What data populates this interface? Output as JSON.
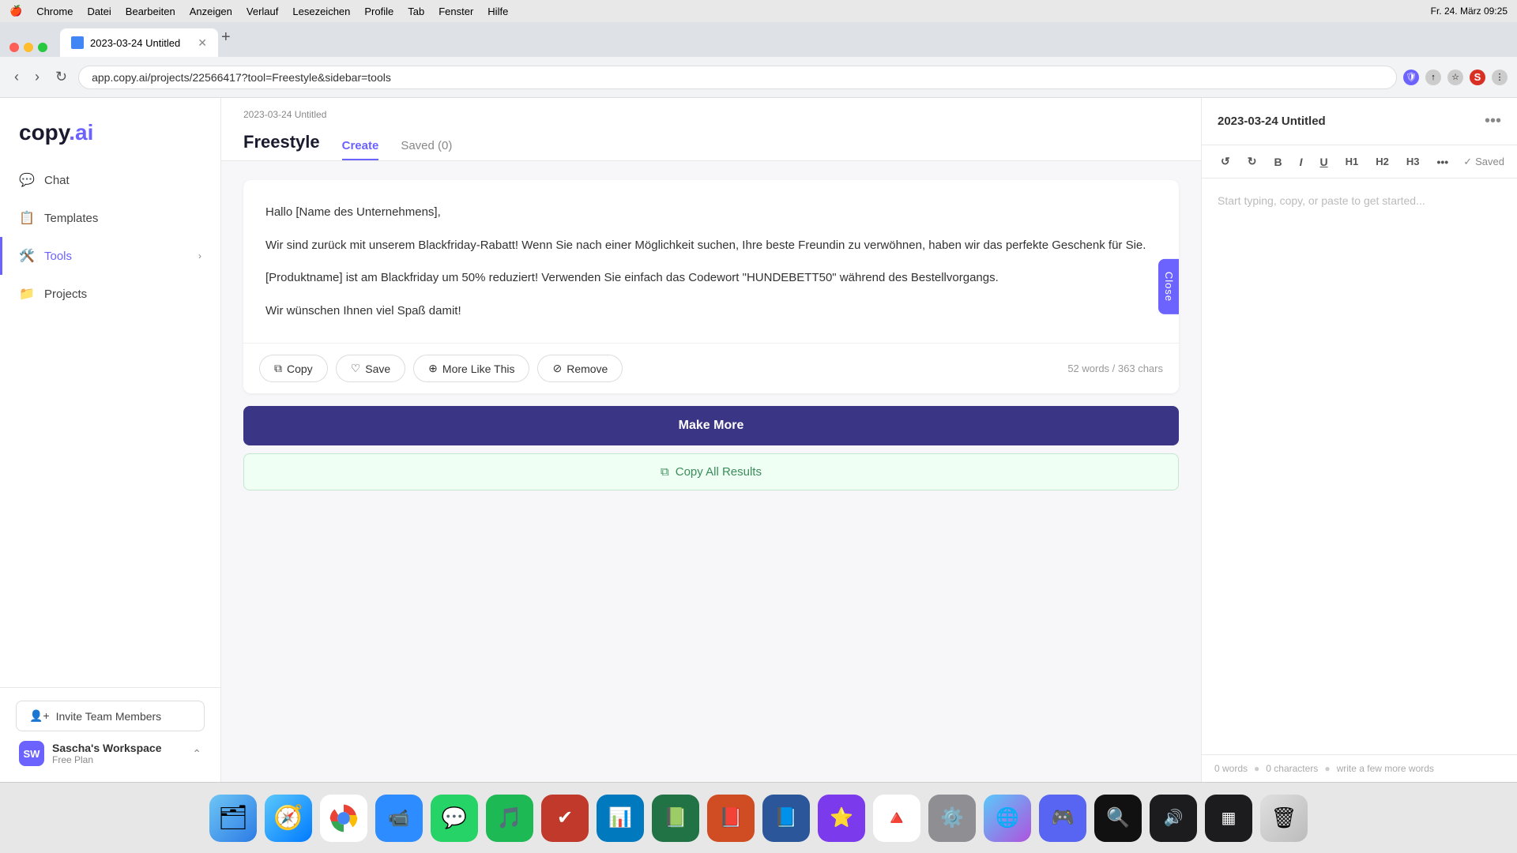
{
  "menubar": {
    "apple": "🍎",
    "items": [
      "Chrome",
      "Datei",
      "Bearbeiten",
      "Anzeigen",
      "Verlauf",
      "Lesezeichen",
      "Profile",
      "Tab",
      "Fenster",
      "Hilfe"
    ],
    "datetime": "Fr. 24. März 09:25"
  },
  "browser": {
    "tab_title": "2023-03-24 Untitled",
    "url": "app.copy.ai/projects/22566417?tool=Freestyle&sidebar=tools"
  },
  "sidebar": {
    "logo": "copy.ai",
    "nav_items": [
      {
        "id": "chat",
        "label": "Chat",
        "icon": "💬"
      },
      {
        "id": "templates",
        "label": "Templates",
        "icon": "📋"
      },
      {
        "id": "tools",
        "label": "Tools",
        "icon": "🛠️",
        "active": true,
        "hasChevron": true
      },
      {
        "id": "projects",
        "label": "Projects",
        "icon": "📁"
      }
    ],
    "invite_label": "Invite Team Members",
    "workspace": {
      "name": "Sascha's Workspace",
      "initials": "SW",
      "plan": "Free Plan"
    }
  },
  "header": {
    "breadcrumb": "2023-03-24 Untitled",
    "title": "Freestyle",
    "tabs": [
      {
        "label": "Create",
        "active": true
      },
      {
        "label": "Saved (0)",
        "active": false
      }
    ]
  },
  "result": {
    "paragraph1": "Hallo [Name des Unternehmens],",
    "paragraph2": "Wir sind zurück mit unserem Blackfriday-Rabatt! Wenn Sie nach einer Möglichkeit suchen, Ihre beste Freundin zu verwöhnen, haben wir das perfekte Geschenk für Sie.",
    "paragraph3": "[Produktname] ist am Blackfriday um 50% reduziert! Verwenden Sie einfach das Codewort \"HUNDEBETT50\" während des Bestellvorgangs.",
    "paragraph4": "Wir wünschen Ihnen viel Spaß damit!",
    "actions": {
      "copy": "Copy",
      "save": "Save",
      "more_like_this": "More Like This",
      "remove": "Remove"
    },
    "word_count": "52 words / 363 chars",
    "close_label": "Close"
  },
  "bottom_actions": {
    "make_more": "Make More",
    "copy_all": "Copy All Results"
  },
  "right_panel": {
    "title": "2023-03-24 Untitled",
    "editor_placeholder": "Start typing, copy, or paste to get started...",
    "saved_label": "Saved",
    "toolbar": {
      "undo": "↺",
      "redo": "↻",
      "bold": "B",
      "italic": "I",
      "underline": "U",
      "h1": "H1",
      "h2": "H2",
      "h3": "H3",
      "more": "•••"
    },
    "footer": {
      "words": "0 words",
      "characters": "0 characters",
      "hint": "write a few more words"
    }
  }
}
